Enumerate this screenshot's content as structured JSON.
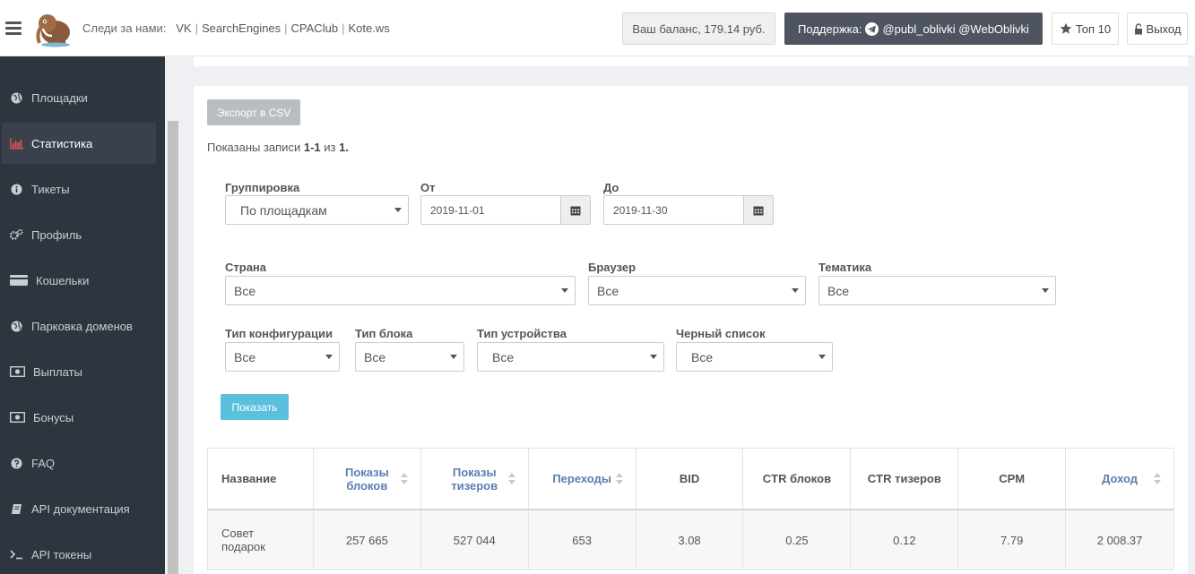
{
  "header": {
    "follow_label": "Следи за нами:",
    "links": [
      "VK",
      "SearchEngines",
      "CPAClub",
      "Kote.ws"
    ],
    "balance": "Ваш баланс, 179.14 руб.",
    "support_label": "Поддержка:",
    "support_handles": "@publ_oblivki @WebOblivki",
    "top10": "Топ 10",
    "logout": "Выход"
  },
  "sidebar": {
    "items": [
      {
        "label": "Площадки",
        "icon": "globe-icon"
      },
      {
        "label": "Статистика",
        "icon": "bar-chart-icon",
        "active": true
      },
      {
        "label": "Тикеты",
        "icon": "info-icon"
      },
      {
        "label": "Профиль",
        "icon": "gears-icon"
      },
      {
        "label": "Кошельки",
        "icon": "credit-card-icon"
      },
      {
        "label": "Парковка доменов",
        "icon": "globe-icon"
      },
      {
        "label": "Выплаты",
        "icon": "money-icon"
      },
      {
        "label": "Бонусы",
        "icon": "money-icon"
      },
      {
        "label": "FAQ",
        "icon": "question-icon"
      },
      {
        "label": "API документация",
        "icon": "book-icon"
      },
      {
        "label": "API токены",
        "icon": "terminal-icon"
      }
    ]
  },
  "content": {
    "export_button": "Экспорт в CSV",
    "records": {
      "prefix": "Показаны записи",
      "range": "1-1",
      "of": "из",
      "total": "1",
      "end": "."
    },
    "filters": {
      "grouping": {
        "label": "Группировка",
        "value": "По площадкам"
      },
      "from": {
        "label": "От",
        "value": "2019-11-01"
      },
      "to": {
        "label": "До",
        "value": "2019-11-30"
      },
      "country": {
        "label": "Страна",
        "value": "Все"
      },
      "browser": {
        "label": "Браузер",
        "value": "Все"
      },
      "theme": {
        "label": "Тематика",
        "value": "Все"
      },
      "config_type": {
        "label": "Тип конфигурации",
        "value": "Все"
      },
      "block_type": {
        "label": "Тип блока",
        "value": "Все"
      },
      "device_type": {
        "label": "Тип устройства",
        "value": "Все"
      },
      "blacklist": {
        "label": "Черный список",
        "value": "Все"
      }
    },
    "show_button": "Показать"
  },
  "table": {
    "headers": [
      {
        "line1": "Название",
        "line2": "",
        "sortable": false
      },
      {
        "line1": "Показы",
        "line2": "блоков",
        "sortable": true
      },
      {
        "line1": "Показы",
        "line2": "тизеров",
        "sortable": true
      },
      {
        "line1": "Переходы",
        "line2": "",
        "sortable": true
      },
      {
        "line1": "BID",
        "line2": "",
        "sortable": false
      },
      {
        "line1": "CTR блоков",
        "line2": "",
        "sortable": false
      },
      {
        "line1": "CTR тизеров",
        "line2": "",
        "sortable": false
      },
      {
        "line1": "CPM",
        "line2": "",
        "sortable": false
      },
      {
        "line1": "Доход",
        "line2": "",
        "sortable": true
      }
    ],
    "rows": [
      {
        "name1": "Совет",
        "name2": "подарок",
        "block_views": "257 665",
        "teaser_views": "527 044",
        "clicks": "653",
        "bid": "3.08",
        "ctr_blocks": "0.25",
        "ctr_teasers": "0.12",
        "cpm": "7.79",
        "income": "2 008.37"
      }
    ]
  },
  "colors": {
    "sidebar": "#2f353f",
    "support": "#4f5560",
    "show_button": "#5bc0de",
    "sort_header": "#5b7eb0"
  }
}
